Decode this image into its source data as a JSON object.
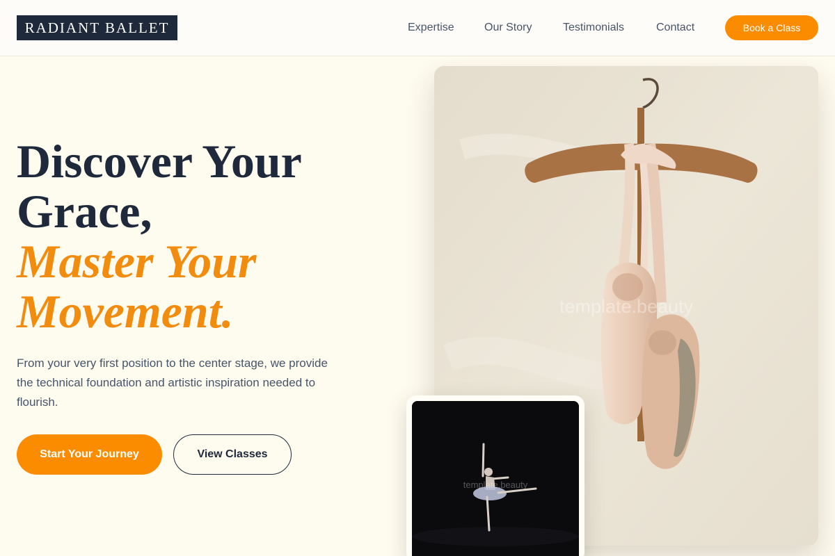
{
  "brand": {
    "logo_text": "RADIANT BALLET"
  },
  "nav": {
    "items": [
      "Expertise",
      "Our Story",
      "Testimonials",
      "Contact"
    ],
    "cta_label": "Book a Class"
  },
  "hero": {
    "title_line1": "Discover Your",
    "title_line2": "Grace,",
    "accent_line1": "Master Your",
    "accent_line2": "Movement.",
    "description": "From your very first position to the center stage, we provide the technical foundation and artistic inspiration needed to flourish.",
    "primary_button": "Start Your Journey",
    "secondary_button": "View Classes"
  },
  "images": {
    "main_watermark": "template.beauty",
    "sub_watermark": "template.beauty"
  },
  "colors": {
    "accent": "#fb8c00",
    "accent_text": "#f28c0f",
    "navy": "#1e293b",
    "background": "#fefbef"
  }
}
